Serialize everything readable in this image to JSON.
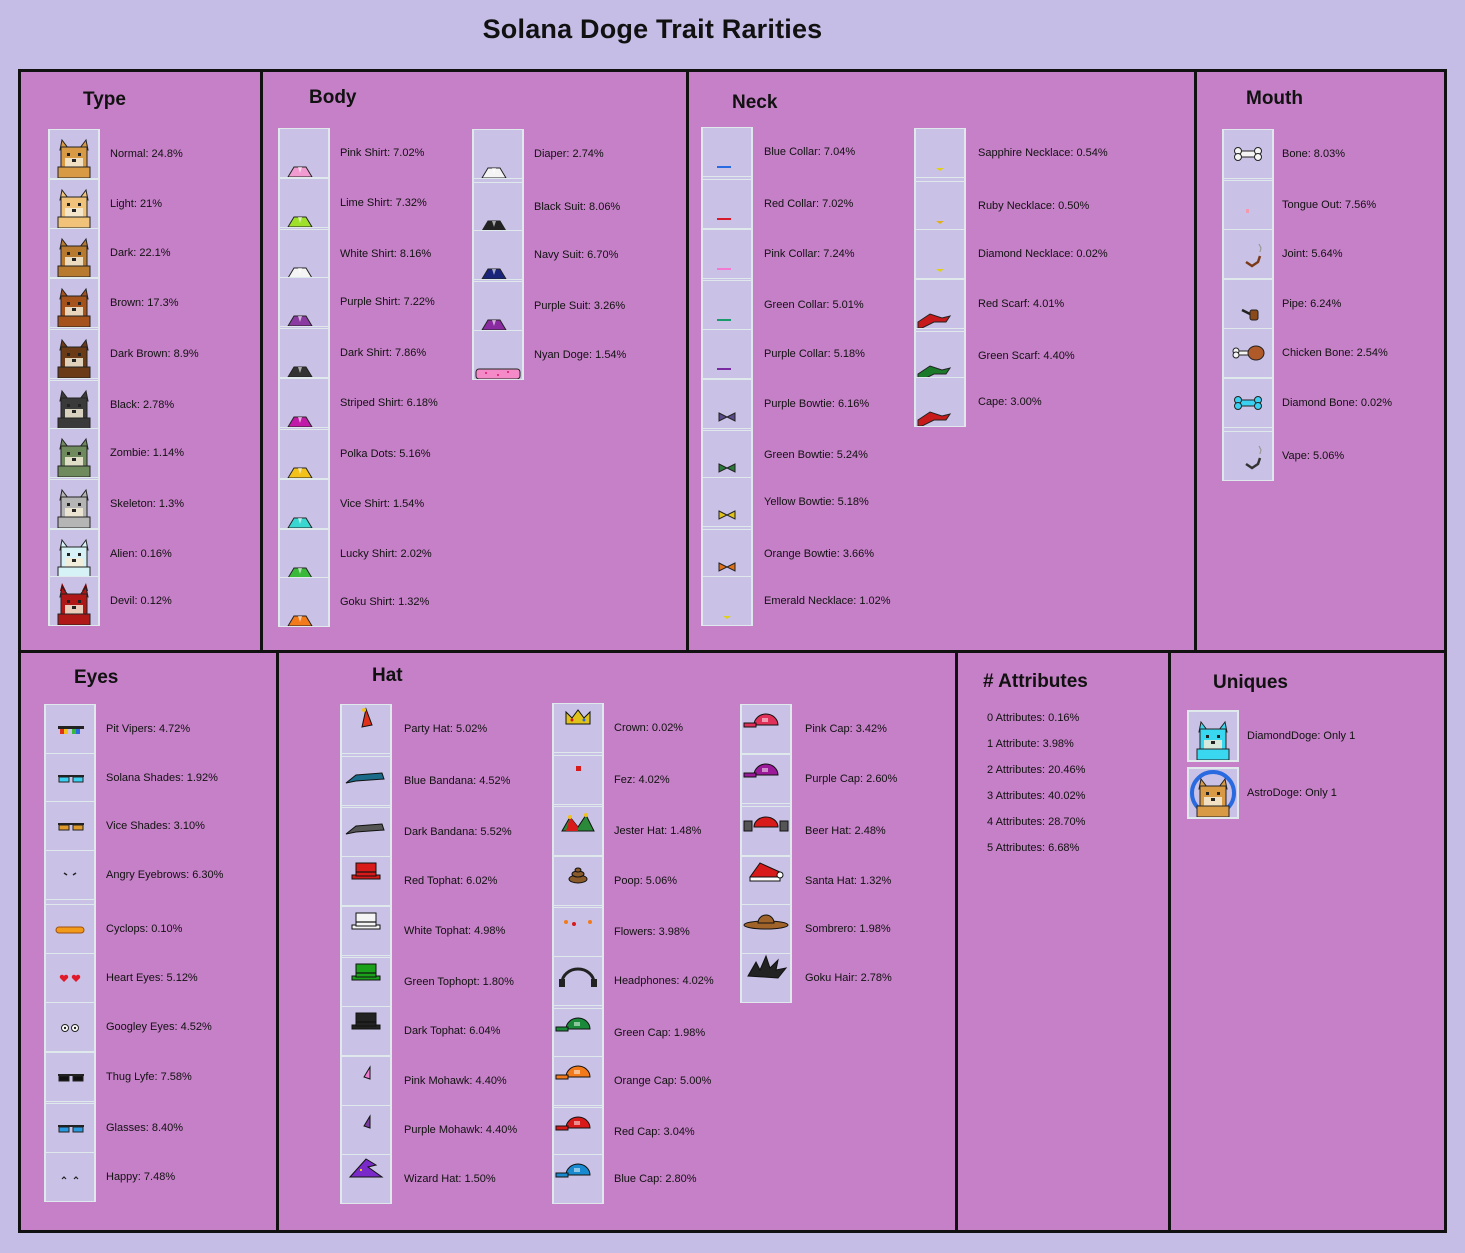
{
  "title": "Solana Doge Trait Rarities",
  "colors": {
    "background": "#c5bde5",
    "panel": "#c580c7",
    "cell": "#c9c2e6",
    "border": "#111111"
  },
  "sections": {
    "type": {
      "title": "Type",
      "items": [
        {
          "label": "Normal: 24.8%",
          "icon": "doge-normal-icon",
          "color": "#d99a45"
        },
        {
          "label": "Light: 21%",
          "icon": "doge-light-icon",
          "color": "#f0c27a"
        },
        {
          "label": "Dark: 22.1%",
          "icon": "doge-dark-icon",
          "color": "#b87a2e"
        },
        {
          "label": "Brown: 17.3%",
          "icon": "doge-brown-icon",
          "color": "#a5521c"
        },
        {
          "label": "Dark Brown: 8.9%",
          "icon": "doge-dark-brown-icon",
          "color": "#6b3a16"
        },
        {
          "label": "Black: 2.78%",
          "icon": "doge-black-icon",
          "color": "#3a3a3a"
        },
        {
          "label": "Zombie: 1.14%",
          "icon": "doge-zombie-icon",
          "color": "#6f8a5c"
        },
        {
          "label": "Skeleton: 1.3%",
          "icon": "doge-skeleton-icon",
          "color": "#b5b5b5"
        },
        {
          "label": "Alien: 0.16%",
          "icon": "doge-alien-icon",
          "color": "#d6f2f7"
        },
        {
          "label": "Devil: 0.12%",
          "icon": "doge-devil-icon",
          "color": "#b01818"
        }
      ]
    },
    "body": {
      "title": "Body",
      "col1": [
        {
          "label": "Pink Shirt: 7.02%",
          "icon": "pink-shirt-icon",
          "color": "#f29bd0"
        },
        {
          "label": "Lime Shirt: 7.32%",
          "icon": "lime-shirt-icon",
          "color": "#9ee02a"
        },
        {
          "label": "White Shirt: 8.16%",
          "icon": "white-shirt-icon",
          "color": "#f4f4f4"
        },
        {
          "label": "Purple Shirt: 7.22%",
          "icon": "purple-shirt-icon",
          "color": "#8a3aa0"
        },
        {
          "label": "Dark Shirt: 7.86%",
          "icon": "dark-shirt-icon",
          "color": "#333333"
        },
        {
          "label": "Striped Shirt: 6.18%",
          "icon": "striped-shirt-icon",
          "color": "#c21aa8"
        },
        {
          "label": "Polka Dots: 5.16%",
          "icon": "polka-dots-icon",
          "color": "#f2c21a"
        },
        {
          "label": "Vice Shirt: 1.54%",
          "icon": "vice-shirt-icon",
          "color": "#3ad7d0"
        },
        {
          "label": "Lucky Shirt: 2.02%",
          "icon": "lucky-shirt-icon",
          "color": "#3ab83a"
        },
        {
          "label": "Goku Shirt: 1.32%",
          "icon": "goku-shirt-icon",
          "color": "#f27a1a"
        }
      ],
      "col2": [
        {
          "label": "Diaper: 2.74%",
          "icon": "diaper-icon",
          "color": "#f4f4f4"
        },
        {
          "label": "Black Suit: 8.06%",
          "icon": "black-suit-icon",
          "color": "#222222"
        },
        {
          "label": "Navy Suit: 6.70%",
          "icon": "navy-suit-icon",
          "color": "#1a237a"
        },
        {
          "label": "Purple Suit: 3.26%",
          "icon": "purple-suit-icon",
          "color": "#8a2aa0"
        },
        {
          "label": "Nyan Doge: 1.54%",
          "icon": "nyan-doge-icon",
          "color": "#f58ac8"
        }
      ]
    },
    "neck": {
      "title": "Neck",
      "col1": [
        {
          "label": "Blue Collar: 7.04%",
          "icon": "blue-collar-icon",
          "color": "#2a6ae0"
        },
        {
          "label": "Red Collar: 7.02%",
          "icon": "red-collar-icon",
          "color": "#d81a2a"
        },
        {
          "label": "Pink Collar: 7.24%",
          "icon": "pink-collar-icon",
          "color": "#f27ad0"
        },
        {
          "label": "Green Collar: 5.01%",
          "icon": "green-collar-icon",
          "color": "#1a9a6a"
        },
        {
          "label": "Purple Collar: 5.18%",
          "icon": "purple-collar-icon",
          "color": "#7a2aa0"
        },
        {
          "label": "Purple Bowtie: 6.16%",
          "icon": "purple-bowtie-icon",
          "color": "#5a4a8a"
        },
        {
          "label": "Green Bowtie: 5.24%",
          "icon": "green-bowtie-icon",
          "color": "#2a7a3a"
        },
        {
          "label": "Yellow Bowtie: 5.18%",
          "icon": "yellow-bowtie-icon",
          "color": "#e0c21a"
        },
        {
          "label": "Orange Bowtie: 3.66%",
          "icon": "orange-bowtie-icon",
          "color": "#e0701a"
        },
        {
          "label": "Emerald Necklace: 1.02%",
          "icon": "emerald-necklace-icon",
          "color": "#e0d01a"
        }
      ],
      "col2": [
        {
          "label": "Sapphire Necklace: 0.54%",
          "icon": "sapphire-necklace-icon",
          "color": "#e0d01a"
        },
        {
          "label": "Ruby Necklace: 0.50%",
          "icon": "ruby-necklace-icon",
          "color": "#e0b01a"
        },
        {
          "label": "Diamond Necklace: 0.02%",
          "icon": "diamond-necklace-icon",
          "color": "#e0d01a"
        },
        {
          "label": "Red Scarf: 4.01%",
          "icon": "red-scarf-icon",
          "color": "#c81a1a"
        },
        {
          "label": "Green Scarf: 4.40%",
          "icon": "green-scarf-icon",
          "color": "#1a7a2a"
        },
        {
          "label": "Cape: 3.00%",
          "icon": "cape-icon",
          "color": "#c81a1a"
        }
      ]
    },
    "mouth": {
      "title": "Mouth",
      "items": [
        {
          "label": "Bone: 8.03%",
          "icon": "bone-icon",
          "color": "#f4f4f4"
        },
        {
          "label": "Tongue Out: 7.56%",
          "icon": "tongue-out-icon",
          "color": "#f29ab0"
        },
        {
          "label": "Joint: 5.64%",
          "icon": "joint-icon",
          "color": "#7a3a1a"
        },
        {
          "label": "Pipe: 6.24%",
          "icon": "pipe-icon",
          "color": "#8a4a1a"
        },
        {
          "label": "Chicken Bone: 2.54%",
          "icon": "chicken-bone-icon",
          "color": "#b05a2a"
        },
        {
          "label": "Diamond Bone: 0.02%",
          "icon": "diamond-bone-icon",
          "color": "#3ad0f2"
        },
        {
          "label": "Vape: 5.06%",
          "icon": "vape-icon",
          "color": "#333333"
        }
      ]
    },
    "eyes": {
      "title": "Eyes",
      "items": [
        {
          "label": "Pit Vipers: 4.72%",
          "icon": "pit-vipers-icon",
          "color": "#e0301a"
        },
        {
          "label": "Solana Shades: 1.92%",
          "icon": "solana-shades-icon",
          "color": "#3ad0f2"
        },
        {
          "label": "Vice Shades: 3.10%",
          "icon": "vice-shades-icon",
          "color": "#e09a2a"
        },
        {
          "label": "Angry Eyebrows: 6.30%",
          "icon": "angry-eyebrows-icon",
          "color": "#222222"
        },
        {
          "label": "Cyclops: 0.10%",
          "icon": "cyclops-icon",
          "color": "#f29a1a"
        },
        {
          "label": "Heart Eyes: 5.12%",
          "icon": "heart-eyes-icon",
          "color": "#e01a2a"
        },
        {
          "label": "Googley Eyes: 4.52%",
          "icon": "googley-eyes-icon",
          "color": "#ffffff"
        },
        {
          "label": "Thug Lyfe: 7.58%",
          "icon": "thug-lyfe-icon",
          "color": "#111111"
        },
        {
          "label": "Glasses: 8.40%",
          "icon": "glasses-icon",
          "color": "#2a9ae0"
        },
        {
          "label": "Happy: 7.48%",
          "icon": "happy-eyes-icon",
          "color": "#222222"
        }
      ]
    },
    "hat": {
      "title": "Hat",
      "col1": [
        {
          "label": "Party Hat: 5.02%",
          "icon": "party-hat-icon",
          "color": "#e0301a"
        },
        {
          "label": "Blue Bandana: 4.52%",
          "icon": "blue-bandana-icon",
          "color": "#1a6a8a"
        },
        {
          "label": "Dark Bandana: 5.52%",
          "icon": "dark-bandana-icon",
          "color": "#555555"
        },
        {
          "label": "Red Tophat: 6.02%",
          "icon": "red-tophat-icon",
          "color": "#d81a1a"
        },
        {
          "label": "White Tophat: 4.98%",
          "icon": "white-tophat-icon",
          "color": "#f4f4f4"
        },
        {
          "label": "Green Tophopt: 1.80%",
          "icon": "green-tophat-icon",
          "color": "#1aa01a"
        },
        {
          "label": "Dark Tophat: 6.04%",
          "icon": "dark-tophat-icon",
          "color": "#222222"
        },
        {
          "label": "Pink Mohawk: 4.40%",
          "icon": "pink-mohawk-icon",
          "color": "#f27ad0"
        },
        {
          "label": "Purple Mohawk: 4.40%",
          "icon": "purple-mohawk-icon",
          "color": "#7a3aa0"
        },
        {
          "label": "Wizard Hat: 1.50%",
          "icon": "wizard-hat-icon",
          "color": "#7a2ac8"
        }
      ],
      "col2": [
        {
          "label": "Crown: 0.02%",
          "icon": "crown-icon",
          "color": "#e0c21a"
        },
        {
          "label": "Fez: 4.02%",
          "icon": "fez-icon",
          "color": "#d81a1a"
        },
        {
          "label": "Jester Hat: 1.48%",
          "icon": "jester-hat-icon",
          "color": "#2a8a3a"
        },
        {
          "label": "Poop: 5.06%",
          "icon": "poop-icon",
          "color": "#8a5a2a"
        },
        {
          "label": "Flowers: 3.98%",
          "icon": "flowers-icon",
          "color": "#f27a1a"
        },
        {
          "label": "Headphones: 4.02%",
          "icon": "headphones-icon",
          "color": "#222222"
        },
        {
          "label": "Green Cap: 1.98%",
          "icon": "green-cap-icon",
          "color": "#1a8a3a"
        },
        {
          "label": "Orange Cap: 5.00%",
          "icon": "orange-cap-icon",
          "color": "#f27a1a"
        },
        {
          "label": "Red Cap: 3.04%",
          "icon": "red-cap-icon",
          "color": "#d81a1a"
        },
        {
          "label": "Blue Cap: 2.80%",
          "icon": "blue-cap-icon",
          "color": "#1a8ad0"
        }
      ],
      "col3": [
        {
          "label": "Pink Cap: 3.42%",
          "icon": "pink-cap-icon",
          "color": "#e0305a"
        },
        {
          "label": "Purple Cap: 2.60%",
          "icon": "purple-cap-icon",
          "color": "#9a1a9a"
        },
        {
          "label": "Beer Hat: 2.48%",
          "icon": "beer-hat-icon",
          "color": "#d81a1a"
        },
        {
          "label": "Santa Hat: 1.32%",
          "icon": "santa-hat-icon",
          "color": "#d81a1a"
        },
        {
          "label": "Sombrero: 1.98%",
          "icon": "sombrero-icon",
          "color": "#a0642a"
        },
        {
          "label": "Goku Hair: 2.78%",
          "icon": "goku-hair-icon",
          "color": "#222222"
        }
      ]
    },
    "attributes": {
      "title": "# Attributes",
      "items": [
        {
          "label": "0 Attributes: 0.16%"
        },
        {
          "label": "1 Attribute: 3.98%"
        },
        {
          "label": "2 Attributes: 20.46%"
        },
        {
          "label": "3 Attributes: 40.02%"
        },
        {
          "label": "4 Attributes: 28.70%"
        },
        {
          "label": "5 Attributes: 6.68%"
        }
      ]
    },
    "uniques": {
      "title": "Uniques",
      "items": [
        {
          "label": "DiamondDoge: Only 1",
          "icon": "diamond-doge-icon",
          "color": "#3ad7f0"
        },
        {
          "label": "AstroDoge: Only 1",
          "icon": "astro-doge-icon",
          "color": "#d99a45"
        }
      ]
    }
  }
}
